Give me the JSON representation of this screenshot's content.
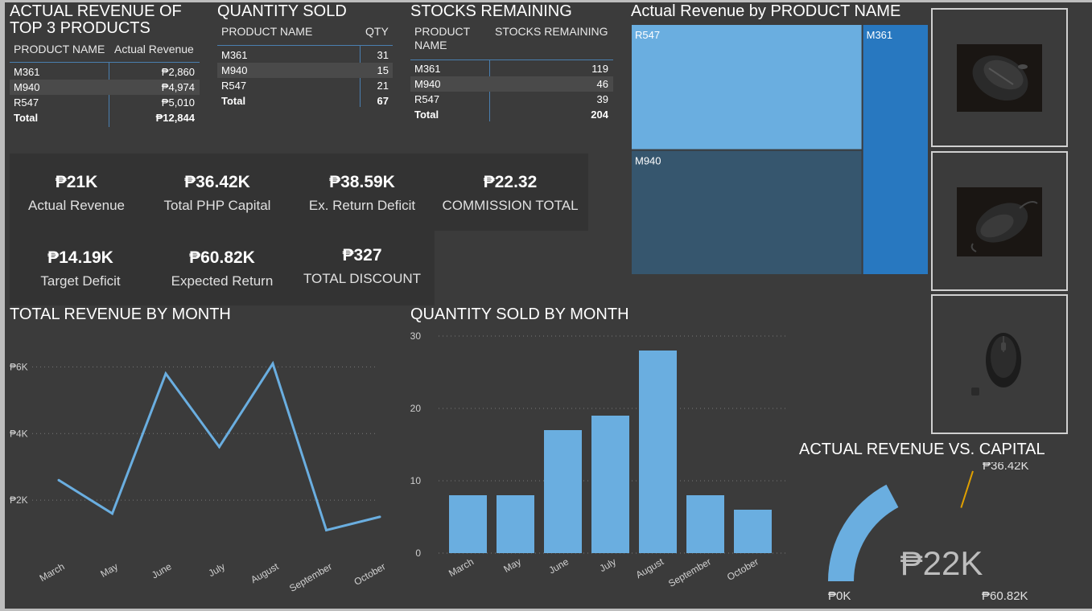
{
  "top_products": {
    "title_line1": "ACTUAL REVENUE OF",
    "title_line2": "TOP 3 PRODUCTS",
    "headers": [
      "PRODUCT NAME",
      "Actual Revenue"
    ],
    "rows": [
      [
        "M361",
        "₱2,860"
      ],
      [
        "M940",
        "₱4,974"
      ],
      [
        "R547",
        "₱5,010"
      ]
    ],
    "total": [
      "Total",
      "₱12,844"
    ]
  },
  "quantity_sold": {
    "title": "QUANTITY SOLD",
    "headers": [
      "PRODUCT NAME",
      "QTY"
    ],
    "rows": [
      [
        "M361",
        "31"
      ],
      [
        "M940",
        "15"
      ],
      [
        "R547",
        "21"
      ]
    ],
    "total": [
      "Total",
      "67"
    ]
  },
  "stocks": {
    "title": "STOCKS REMAINING",
    "headers": [
      "PRODUCT",
      "NAME",
      "STOCKS REMAINING"
    ],
    "rows": [
      [
        "M361",
        "119"
      ],
      [
        "M940",
        "46"
      ],
      [
        "R547",
        "39"
      ]
    ],
    "total": [
      "Total",
      "204"
    ]
  },
  "kpis": [
    {
      "value": "₱21K",
      "label": "Actual Revenue"
    },
    {
      "value": "₱36.42K",
      "label": "Total PHP Capital"
    },
    {
      "value": "₱38.59K",
      "label": "Ex. Return Deficit"
    },
    {
      "value": "₱22.32",
      "label": "COMMISSION TOTAL"
    },
    {
      "value": "₱14.19K",
      "label": "Target Deficit"
    },
    {
      "value": "₱60.82K",
      "label": "Expected Return"
    },
    {
      "value": "₱327",
      "label": "TOTAL DISCOUNT"
    }
  ],
  "colors": {
    "bg": "#3b3b3b",
    "panel": "#333333",
    "series": "#6aaee0",
    "treemap_r547": "#6aaee0",
    "treemap_m940": "#36566e",
    "treemap_m361": "#2878c0",
    "gauge_target": "#e0a000"
  },
  "chart_data": [
    {
      "type": "treemap",
      "title": "Actual Revenue by PRODUCT NAME",
      "categories": [
        "R547",
        "M940",
        "M361"
      ],
      "values": [
        5010,
        4974,
        2860
      ]
    },
    {
      "type": "line",
      "title": "TOTAL REVENUE BY MONTH",
      "categories": [
        "March",
        "May",
        "June",
        "July",
        "August",
        "September",
        "October"
      ],
      "values": [
        2600,
        1600,
        5800,
        3600,
        6100,
        1100,
        1500
      ],
      "yticks": [
        "₱2K",
        "₱4K",
        "₱6K"
      ],
      "ytick_values": [
        2000,
        4000,
        6000
      ],
      "ylim": [
        0,
        7000
      ],
      "grid": true
    },
    {
      "type": "bar",
      "title": "QUANTITY SOLD BY MONTH",
      "categories": [
        "March",
        "May",
        "June",
        "July",
        "August",
        "September",
        "October"
      ],
      "values": [
        8,
        8,
        17,
        19,
        28,
        8,
        6
      ],
      "yticks": [
        "0",
        "10",
        "20",
        "30"
      ],
      "ytick_values": [
        0,
        10,
        20,
        30
      ],
      "ylim": [
        0,
        30
      ],
      "grid": true
    },
    {
      "type": "gauge",
      "title": "ACTUAL REVENUE VS. CAPITAL",
      "value": 21000,
      "value_label": "₱22K",
      "min": 0,
      "min_label": "₱0K",
      "max": 60820,
      "max_label": "₱60.82K",
      "target": 36420,
      "target_label": "₱36.42K"
    }
  ],
  "product_images": [
    {
      "icon": "gaming-mouse-photo"
    },
    {
      "icon": "wired-mouse-photo"
    },
    {
      "icon": "wireless-mouse-photo"
    }
  ]
}
